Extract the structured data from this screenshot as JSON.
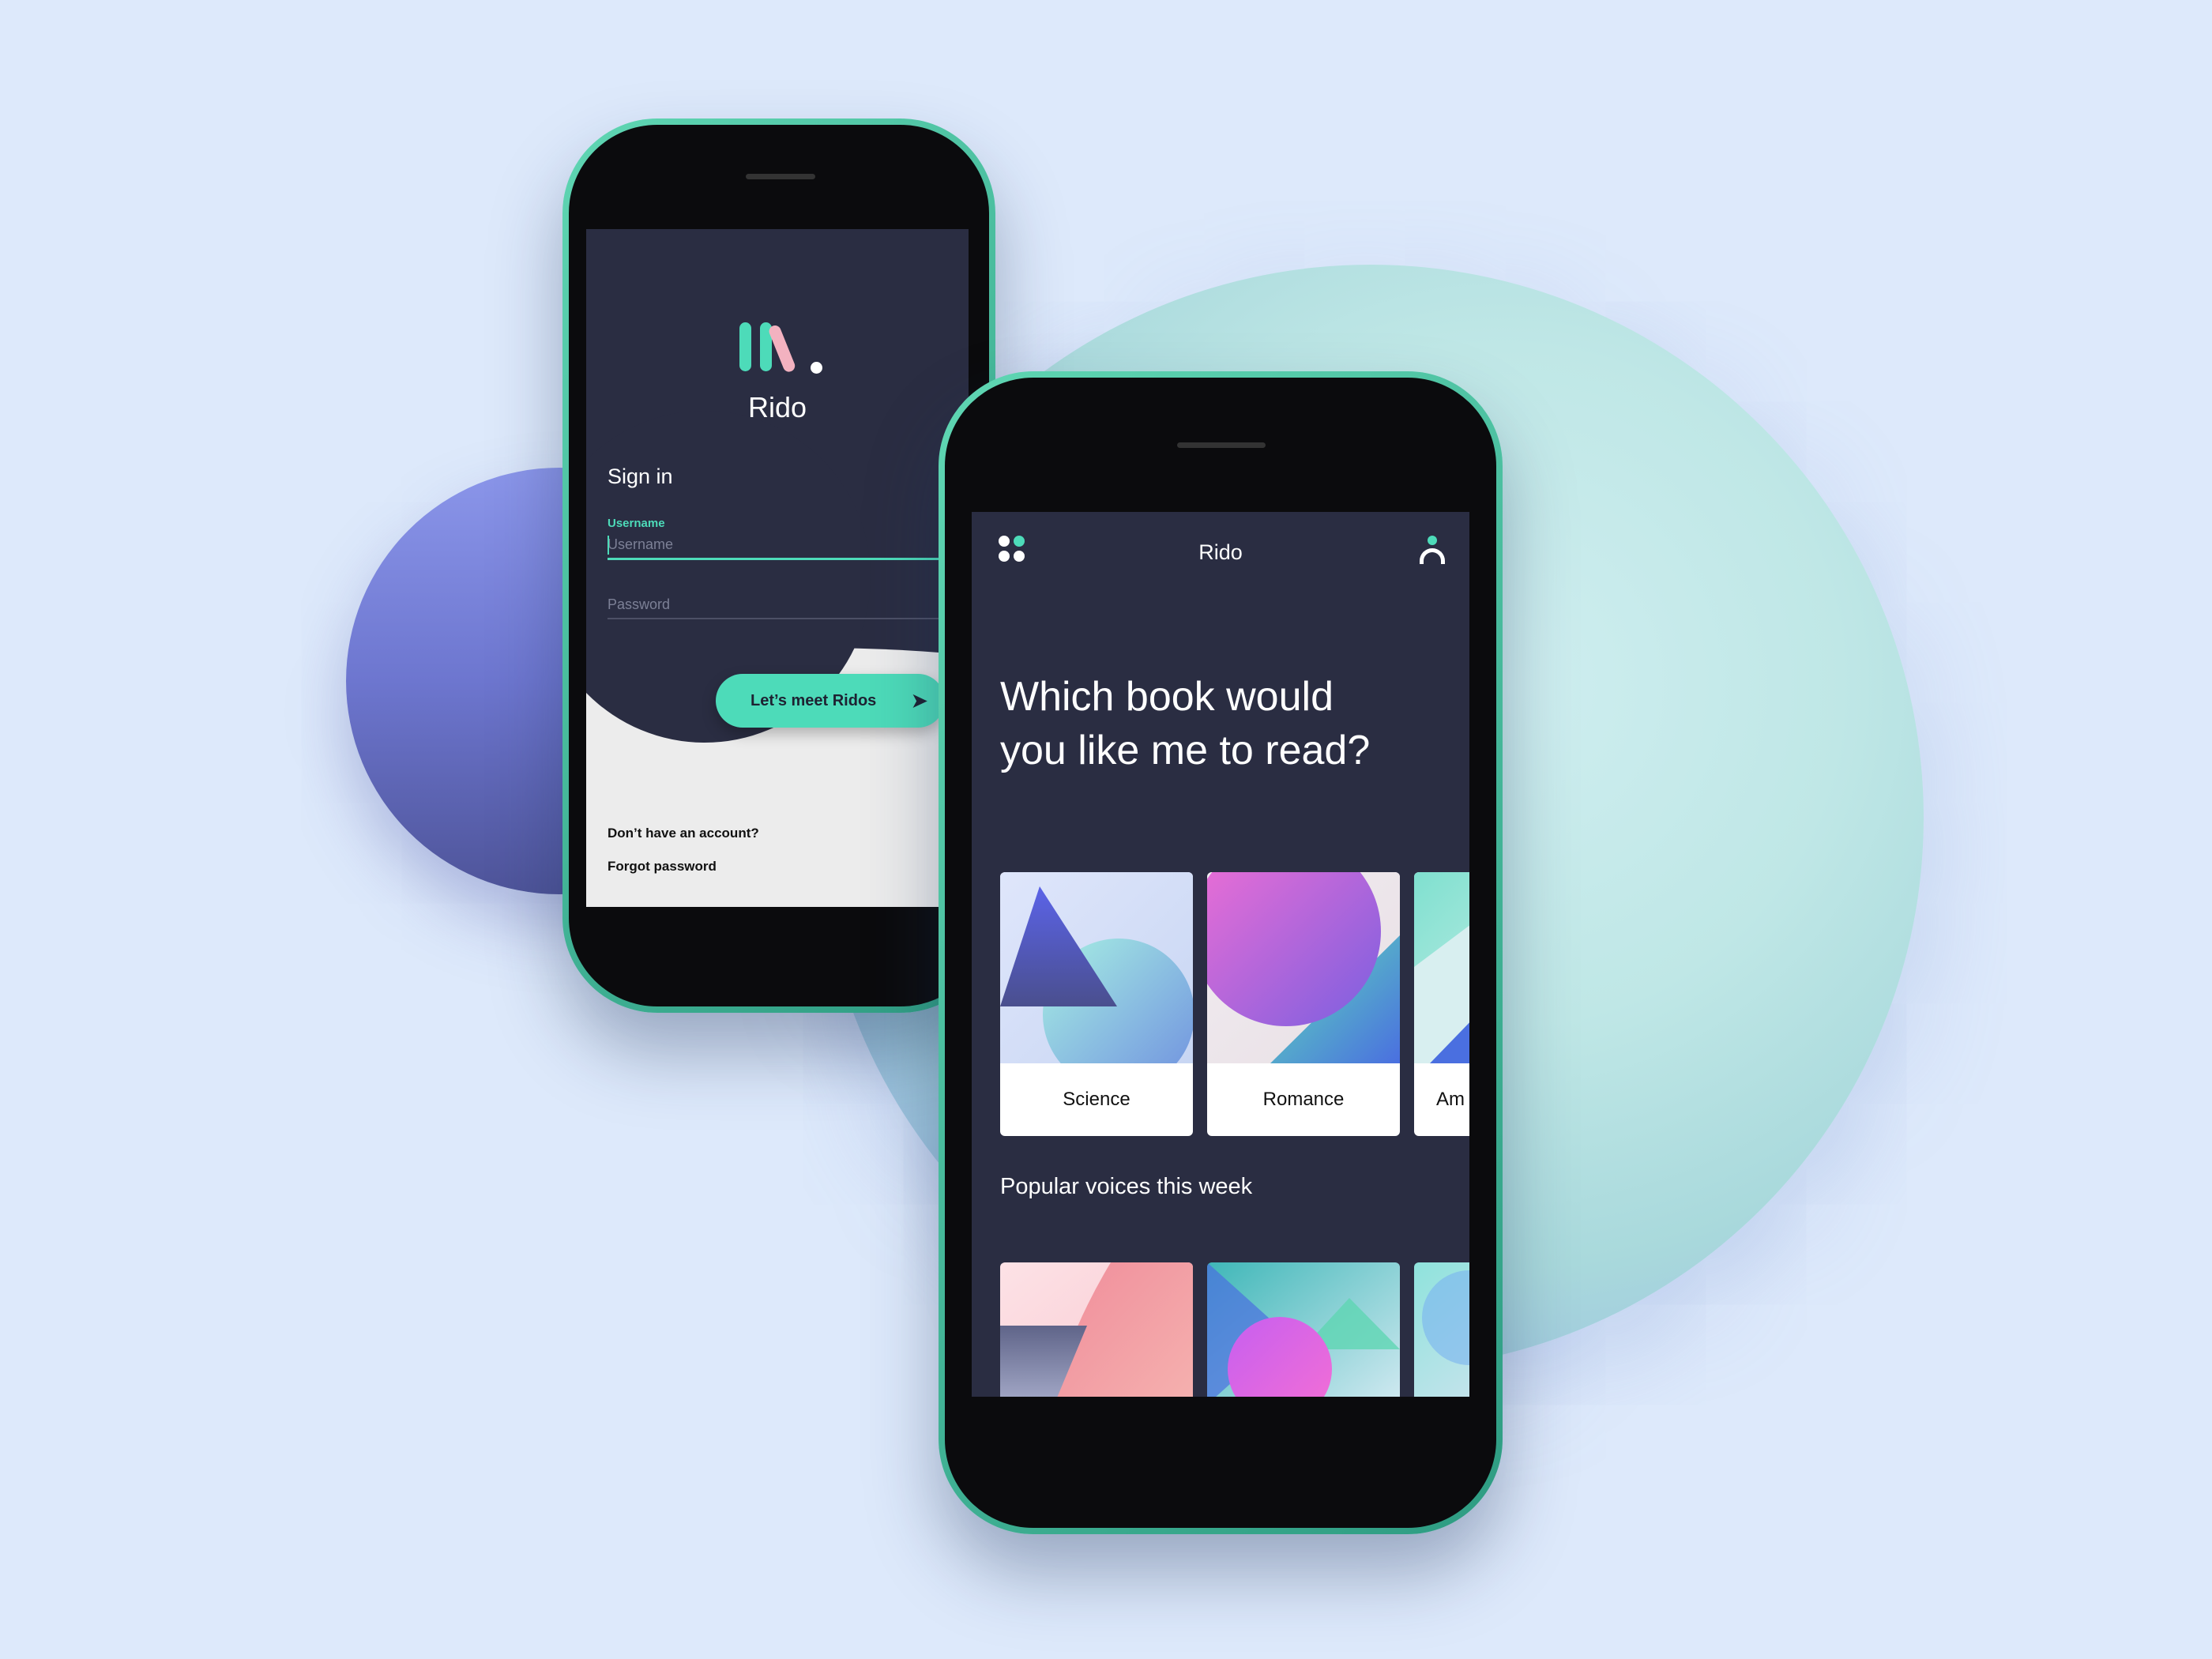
{
  "signin_screen": {
    "app_name": "Rido",
    "title": "Sign in",
    "username_label": "Username",
    "username_placeholder": "Username",
    "password_placeholder": "Password",
    "cta_label": "Let’s meet Ridos",
    "no_account_link": "Don’t have an account?",
    "forgot_password_link": "Forgot password"
  },
  "home_screen": {
    "title": "Rido",
    "headline": "Which book would you like me to read?",
    "genres": [
      {
        "label": "Science"
      },
      {
        "label": "Romance"
      },
      {
        "label": "Am"
      }
    ],
    "popular_section_title": "Popular voices this week"
  },
  "colors": {
    "accent": "#4ddbb9",
    "screen_bg": "#2a2d42",
    "page_bg": "#dde9fb",
    "pink": "#f3b2c0"
  },
  "icons": {
    "menu": "grid-dots-icon",
    "profile": "user-icon",
    "cta": "arrow-right-icon"
  }
}
